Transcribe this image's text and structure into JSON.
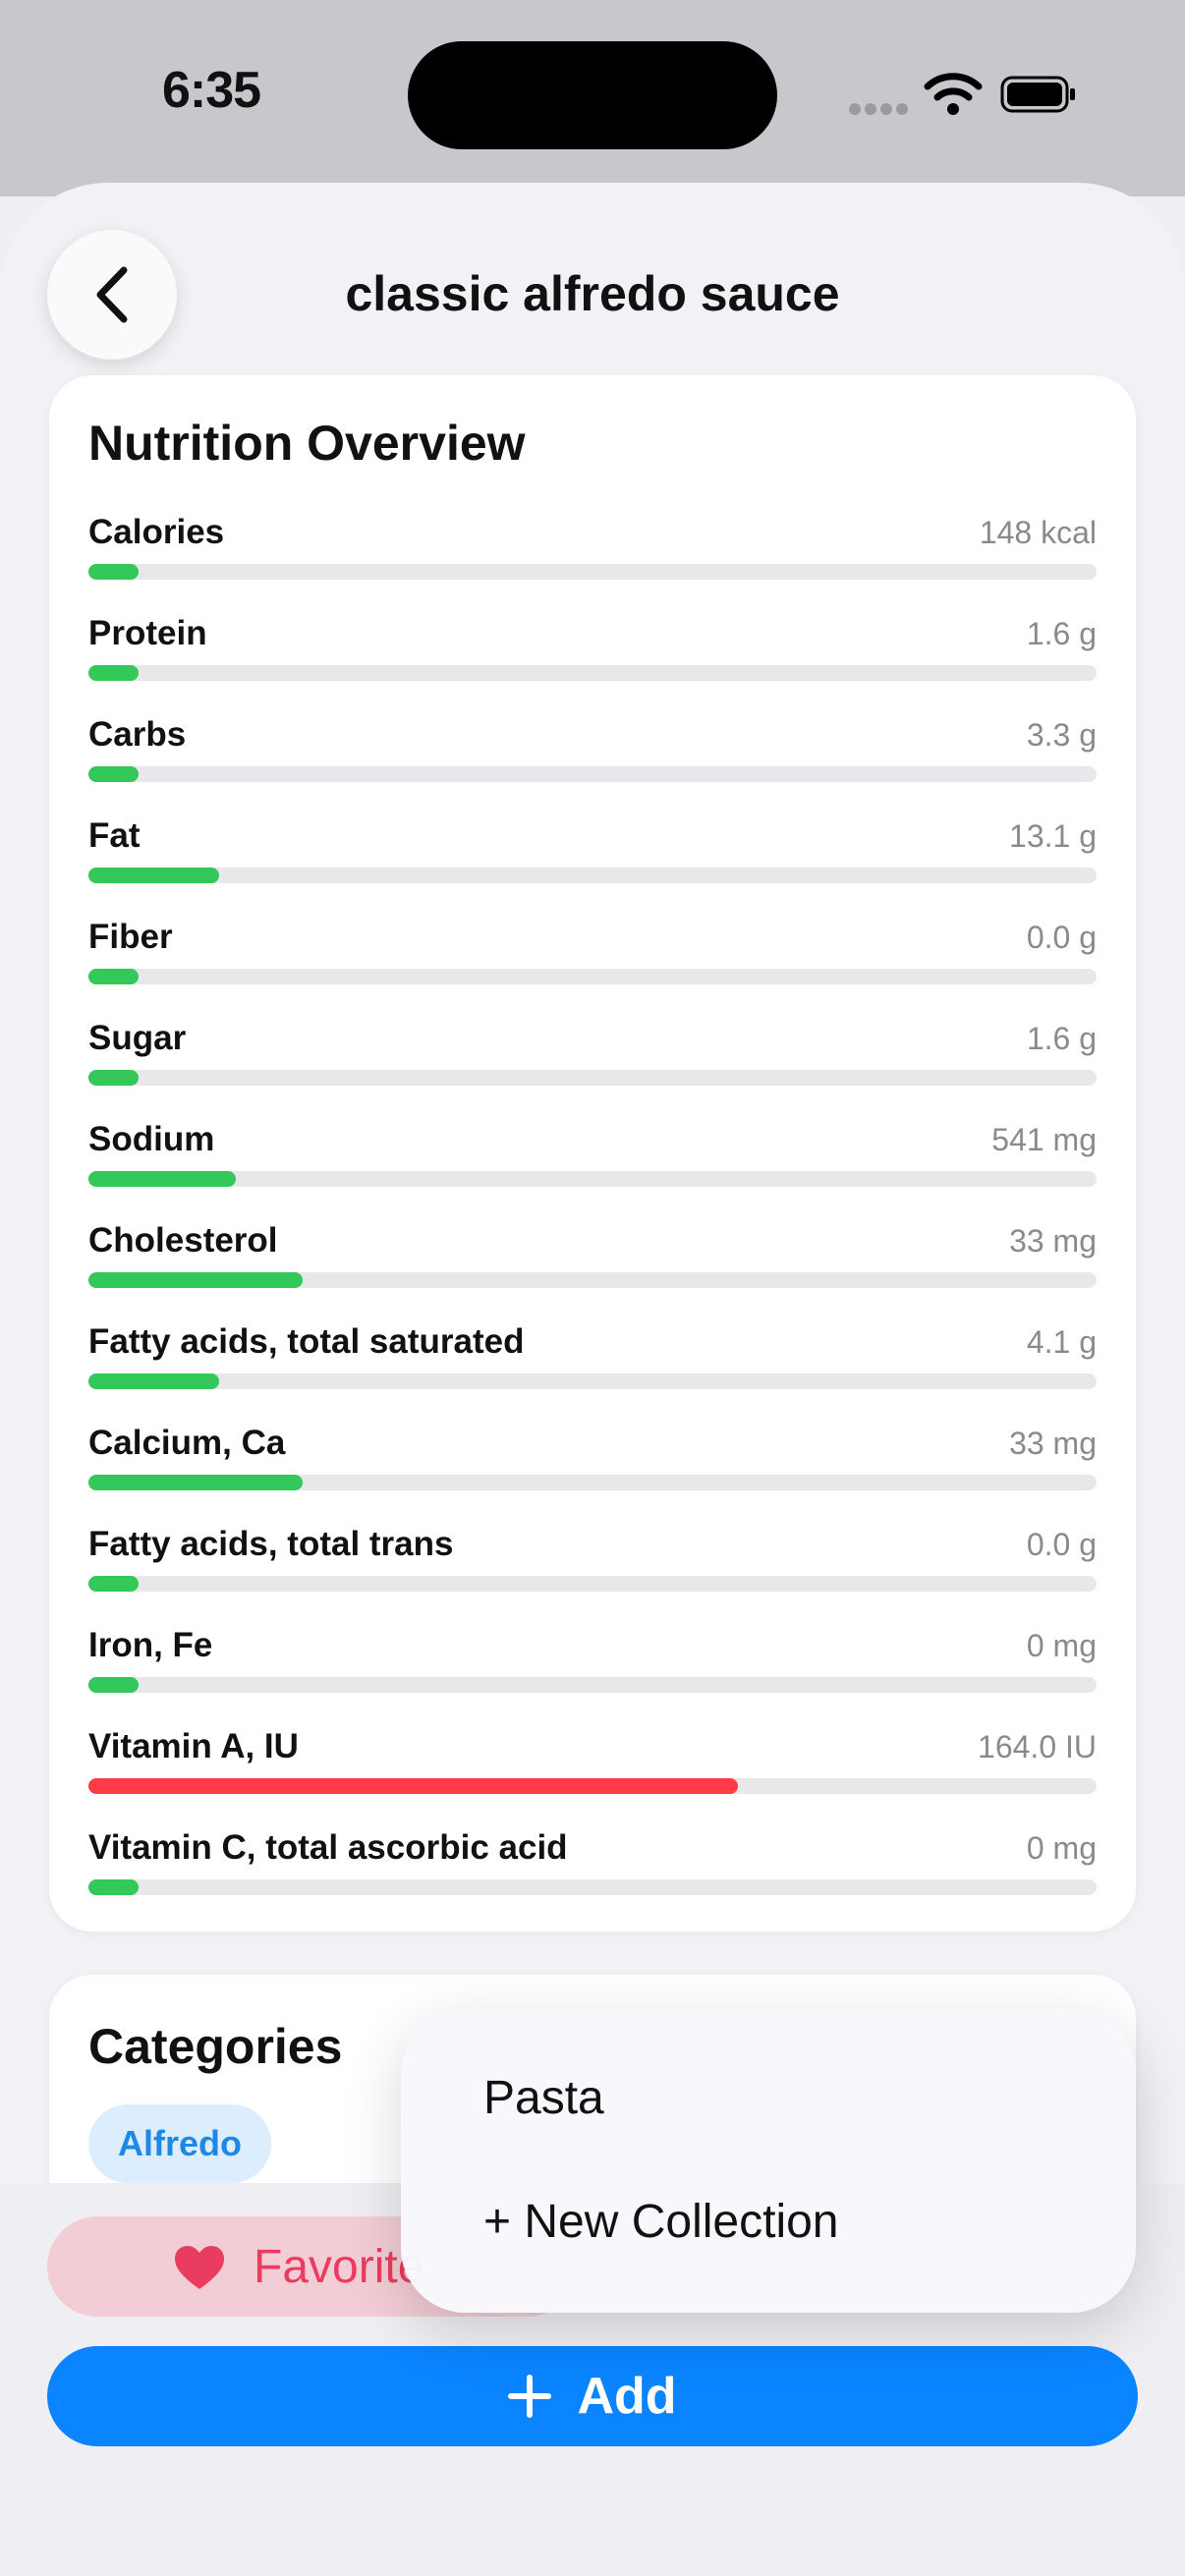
{
  "status": {
    "time": "6:35"
  },
  "nav": {
    "title": "classic alfredo sauce"
  },
  "nutrition": {
    "title": "Nutrition Overview",
    "rows": [
      {
        "label": "Calories",
        "value": "148 kcal",
        "fill": 0.05,
        "color": "#34c759"
      },
      {
        "label": "Protein",
        "value": "1.6 g",
        "fill": 0.05,
        "color": "#34c759"
      },
      {
        "label": "Carbs",
        "value": "3.3 g",
        "fill": 0.05,
        "color": "#34c759"
      },
      {
        "label": "Fat",
        "value": "13.1 g",
        "fill": 0.13,
        "color": "#34c759"
      },
      {
        "label": "Fiber",
        "value": "0.0 g",
        "fill": 0.05,
        "color": "#34c759"
      },
      {
        "label": "Sugar",
        "value": "1.6 g",
        "fill": 0.05,
        "color": "#34c759"
      },
      {
        "label": "Sodium",
        "value": "541 mg",
        "fill": 0.146,
        "color": "#34c759"
      },
      {
        "label": "Cholesterol",
        "value": "33 mg",
        "fill": 0.212,
        "color": "#34c759"
      },
      {
        "label": "Fatty acids, total saturated",
        "value": "4.1 g",
        "fill": 0.13,
        "color": "#34c759"
      },
      {
        "label": "Calcium, Ca",
        "value": "33 mg",
        "fill": 0.212,
        "color": "#34c759"
      },
      {
        "label": "Fatty acids, total trans",
        "value": "0.0 g",
        "fill": 0.05,
        "color": "#34c759"
      },
      {
        "label": "Iron, Fe",
        "value": "0 mg",
        "fill": 0.05,
        "color": "#34c759"
      },
      {
        "label": "Vitamin A, IU",
        "value": "164.0 IU",
        "fill": 0.644,
        "color": "#ff3b45"
      },
      {
        "label": "Vitamin C, total ascorbic acid",
        "value": "0 mg",
        "fill": 0.05,
        "color": "#34c759"
      }
    ]
  },
  "categories": {
    "title": "Categories",
    "chip": "Alfredo"
  },
  "actions": {
    "favorite_label": "Favorite",
    "add_label": "Add"
  },
  "collection_menu": {
    "items": [
      "Pasta",
      "+ New Collection"
    ]
  }
}
